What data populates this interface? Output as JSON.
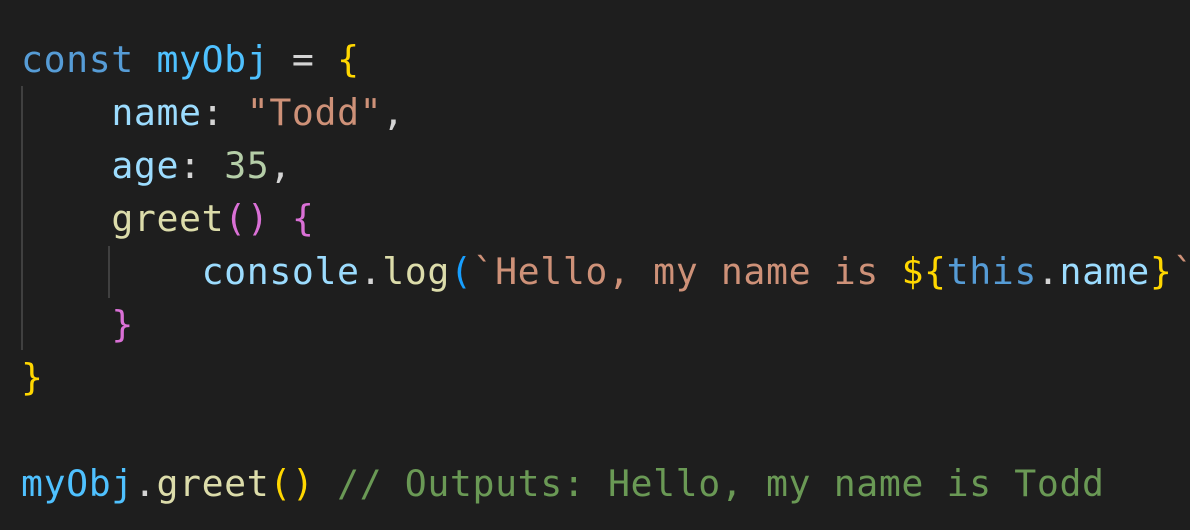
{
  "code": {
    "l1": {
      "kw": "const",
      "var": "myObj",
      "op": "=",
      "brace": "{"
    },
    "l2": {
      "prop": "name",
      "colon": ":",
      "str": "\"Todd\"",
      "comma": ","
    },
    "l3": {
      "prop": "age",
      "colon": ":",
      "num": "35",
      "comma": ","
    },
    "l4": {
      "fn": "greet",
      "paren_open": "(",
      "paren_close": ")",
      "brace": "{"
    },
    "l5": {
      "obj": "console",
      "dot": ".",
      "fn": "log",
      "paren_open": "(",
      "tpl_start": "`Hello, my name is ",
      "interp_open": "${",
      "interp_brace": "{",
      "this": "this",
      "dot2": ".",
      "prop": "name",
      "interp_close": "}",
      "tpl_end": "`",
      "paren_close": ")"
    },
    "l6": {
      "brace": "}"
    },
    "l7": {
      "brace": "}"
    },
    "l9": {
      "var": "myObj",
      "dot": ".",
      "fn": "greet",
      "paren_open": "(",
      "paren_close": ")",
      "comment": "// Outputs: Hello, my name is Todd"
    }
  },
  "colors": {
    "background": "#1e1e1e",
    "keyword": "#569cd6",
    "variable": "#4fc1ff",
    "property": "#9cdcfe",
    "function": "#dcdcaa",
    "string": "#ce9178",
    "number": "#b5cea8",
    "comment": "#6a9955",
    "bracket_level1": "#ffd700",
    "bracket_level2": "#da70d6",
    "bracket_level3": "#179fff"
  }
}
